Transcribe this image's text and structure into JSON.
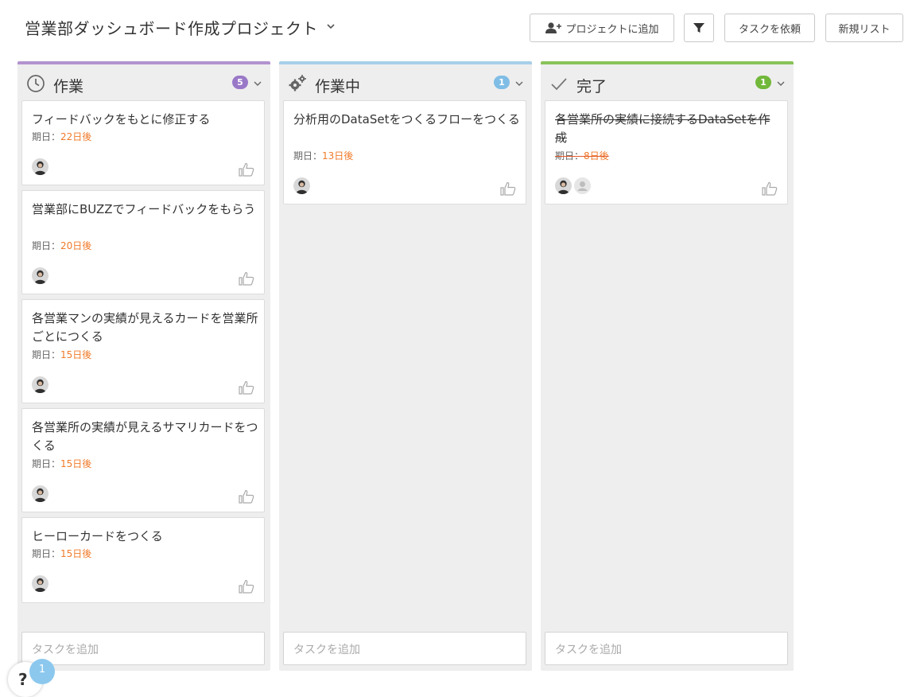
{
  "project": {
    "title": "営業部ダッシュボード作成プロジェクト"
  },
  "toolbar": {
    "add_to_project": "プロジェクトに追加",
    "request_task": "タスクを依頼",
    "new_list": "新規リスト"
  },
  "due_prefix": "期日：",
  "add_task_placeholder": "タスクを追加",
  "columns": [
    {
      "title": "作業",
      "count": "5",
      "icon": "clock-icon",
      "accent": "#b393cf",
      "cards": [
        {
          "title": "フィードバックをもとに修正する",
          "due": "22日後"
        },
        {
          "title": "営業部にBUZZでフィードバックをもらう",
          "due": "20日後"
        },
        {
          "title": "各営業マンの実績が見えるカードを営業所ごとにつくる",
          "due": "15日後"
        },
        {
          "title": "各営業所の実績が見えるサマリカードをつくる",
          "due": "15日後"
        },
        {
          "title": "ヒーローカードをつくる",
          "due": "15日後"
        }
      ]
    },
    {
      "title": "作業中",
      "count": "1",
      "icon": "gears-icon",
      "accent": "#a7cfe9",
      "cards": [
        {
          "title": "分析用のDataSetをつくるフローをつくる",
          "due": "13日後"
        }
      ]
    },
    {
      "title": "完了",
      "count": "1",
      "icon": "checkmark-icon",
      "accent": "#8ac35a",
      "cards": [
        {
          "title": "各営業所の実績に接続するDataSetを作成",
          "due": "8日後",
          "done": true
        }
      ]
    }
  ],
  "help": {
    "symbol": "?",
    "badge": "1"
  },
  "colors": {
    "due_orange": "#f07a2a",
    "column_bg": "#eeeeee",
    "badge_purple": "#9a78c8",
    "badge_blue": "#7fbde6",
    "badge_green": "#71b83a"
  }
}
